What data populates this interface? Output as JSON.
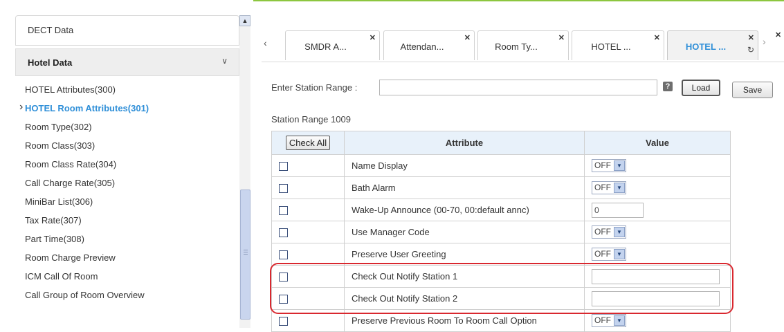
{
  "sidebar": {
    "dect_label": "DECT Data",
    "section_title": "Hotel Data",
    "items": [
      "HOTEL Attributes(300)",
      "HOTEL Room Attributes(301)",
      "Room Type(302)",
      "Room Class(303)",
      "Room Class Rate(304)",
      "Call Charge Rate(305)",
      "MiniBar List(306)",
      "Tax Rate(307)",
      "Part Time(308)",
      "Room Charge Preview",
      "ICM Call Of Room",
      "Call Group of Room Overview"
    ],
    "active_index": 1
  },
  "tabs": [
    {
      "label": "SMDR A..."
    },
    {
      "label": "Attendan..."
    },
    {
      "label": "Room Ty..."
    },
    {
      "label": "HOTEL ..."
    },
    {
      "label": "HOTEL ...",
      "active": true
    }
  ],
  "toolbar": {
    "range_label": "Enter Station Range :",
    "range_value": "",
    "load_label": "Load",
    "save_label": "Save",
    "help_glyph": "?"
  },
  "station_range_text": "Station Range 1009",
  "table": {
    "check_all_label": "Check All",
    "col_attribute": "Attribute",
    "col_value": "Value",
    "rows": [
      {
        "attribute": "Name Display",
        "type": "select",
        "value": "OFF"
      },
      {
        "attribute": "Bath Alarm",
        "type": "select",
        "value": "OFF"
      },
      {
        "attribute": "Wake-Up Announce (00-70, 00:default annc)",
        "type": "text",
        "value": "0"
      },
      {
        "attribute": "Use Manager Code",
        "type": "select",
        "value": "OFF"
      },
      {
        "attribute": "Preserve User Greeting",
        "type": "select",
        "value": "OFF"
      },
      {
        "attribute": "Check Out Notify Station 1",
        "type": "text",
        "value": ""
      },
      {
        "attribute": "Check Out Notify Station 2",
        "type": "text",
        "value": ""
      },
      {
        "attribute": "Preserve Previous Room To Room Call Option",
        "type": "select",
        "value": "OFF"
      }
    ]
  },
  "colors": {
    "accent_blue": "#2f8fd8",
    "frame_green": "#8cc63f",
    "highlight_red": "#d9282f",
    "header_bg": "#e8f1fa"
  }
}
